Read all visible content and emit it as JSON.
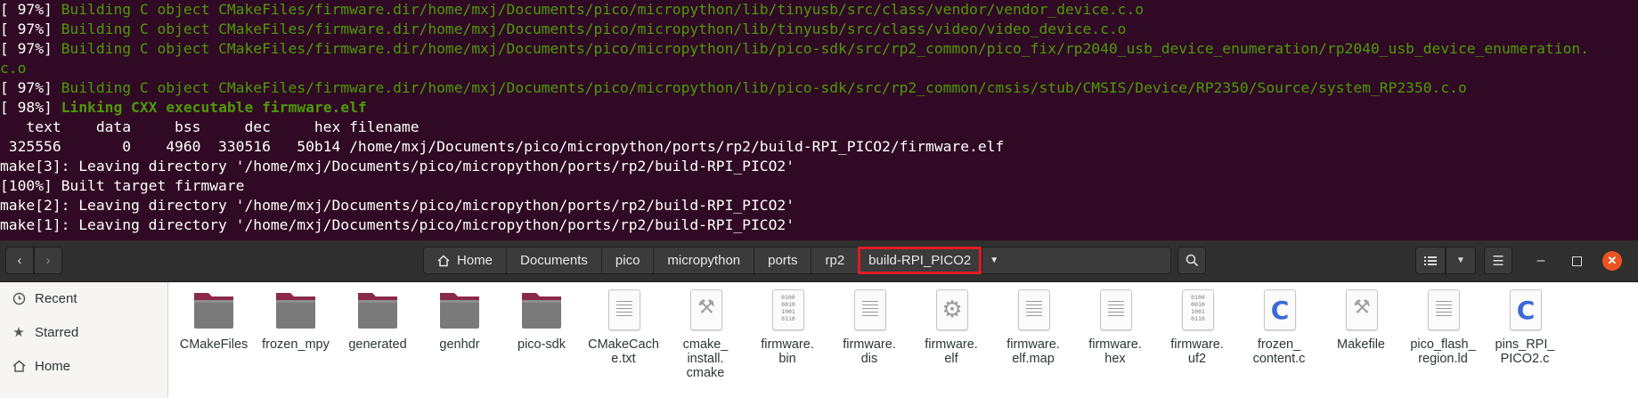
{
  "terminal": {
    "lines": [
      {
        "prefix": "[ 97%] ",
        "text": "Building C object CMakeFiles/firmware.dir/home/mxj/Documents/pico/micropython/lib/tinyusb/src/class/vendor/vendor_device.c.o",
        "style": "green"
      },
      {
        "prefix": "[ 97%] ",
        "text": "Building C object CMakeFiles/firmware.dir/home/mxj/Documents/pico/micropython/lib/tinyusb/src/class/video/video_device.c.o",
        "style": "green"
      },
      {
        "prefix": "[ 97%] ",
        "text": "Building C object CMakeFiles/firmware.dir/home/mxj/Documents/pico/micropython/lib/pico-sdk/src/rp2_common/pico_fix/rp2040_usb_device_enumeration/rp2040_usb_device_enumeration.",
        "style": "green"
      },
      {
        "prefix": "",
        "text": "c.o",
        "style": "green"
      },
      {
        "prefix": "[ 97%] ",
        "text": "Building C object CMakeFiles/firmware.dir/home/mxj/Documents/pico/micropython/lib/pico-sdk/src/rp2_common/cmsis/stub/CMSIS/Device/RP2350/Source/system_RP2350.c.o",
        "style": "green"
      },
      {
        "prefix": "[ 98%] ",
        "text": "Linking CXX executable firmware.elf",
        "style": "green-bold"
      },
      {
        "prefix": "",
        "text": "   text    data     bss     dec     hex filename",
        "style": "plain"
      },
      {
        "prefix": "",
        "text": " 325556       0    4960  330516   50b14 /home/mxj/Documents/pico/micropython/ports/rp2/build-RPI_PICO2/firmware.elf",
        "style": "plain"
      },
      {
        "prefix": "",
        "text": "make[3]: Leaving directory '/home/mxj/Documents/pico/micropython/ports/rp2/build-RPI_PICO2'",
        "style": "plain"
      },
      {
        "prefix": "",
        "text": "[100%] Built target firmware",
        "style": "plain"
      },
      {
        "prefix": "",
        "text": "make[2]: Leaving directory '/home/mxj/Documents/pico/micropython/ports/rp2/build-RPI_PICO2'",
        "style": "plain"
      },
      {
        "prefix": "",
        "text": "make[1]: Leaving directory '/home/mxj/Documents/pico/micropython/ports/rp2/build-RPI_PICO2'",
        "style": "plain"
      }
    ]
  },
  "breadcrumb": [
    "Home",
    "Documents",
    "pico",
    "micropython",
    "ports",
    "rp2",
    "build-RPI_PICO2"
  ],
  "sidebar": {
    "items": [
      {
        "label": "Recent",
        "icon": "clock-icon"
      },
      {
        "label": "Starred",
        "icon": "star-icon"
      },
      {
        "label": "Home",
        "icon": "home-icon"
      }
    ]
  },
  "files": [
    {
      "name": "CMakeFiles",
      "type": "folder"
    },
    {
      "name": "frozen_mpy",
      "type": "folder"
    },
    {
      "name": "generated",
      "type": "folder"
    },
    {
      "name": "genhdr",
      "type": "folder"
    },
    {
      "name": "pico-sdk",
      "type": "folder"
    },
    {
      "name": "CMakeCach\ne.txt",
      "type": "text"
    },
    {
      "name": "cmake_\ninstall.\ncmake",
      "type": "script"
    },
    {
      "name": "firmware.\nbin",
      "type": "binary"
    },
    {
      "name": "firmware.\ndis",
      "type": "text"
    },
    {
      "name": "firmware.\nelf",
      "type": "executable"
    },
    {
      "name": "firmware.\nelf.map",
      "type": "text"
    },
    {
      "name": "firmware.\nhex",
      "type": "text"
    },
    {
      "name": "firmware.\nuf2",
      "type": "binary"
    },
    {
      "name": "frozen_\ncontent.c",
      "type": "c-source"
    },
    {
      "name": "Makefile",
      "type": "script"
    },
    {
      "name": "pico_flash_\nregion.ld",
      "type": "text"
    },
    {
      "name": "pins_RPI_\nPICO2.c",
      "type": "c-source"
    }
  ],
  "colors": {
    "terminal_bg": "#300a24",
    "terminal_green": "#4e9a06",
    "headerbar_bg": "#2f2f2f",
    "highlight_border": "#e01b24",
    "folder_tab": "#8a2a4a",
    "folder_body": "#7a7a7a",
    "close_button": "#e95420"
  }
}
